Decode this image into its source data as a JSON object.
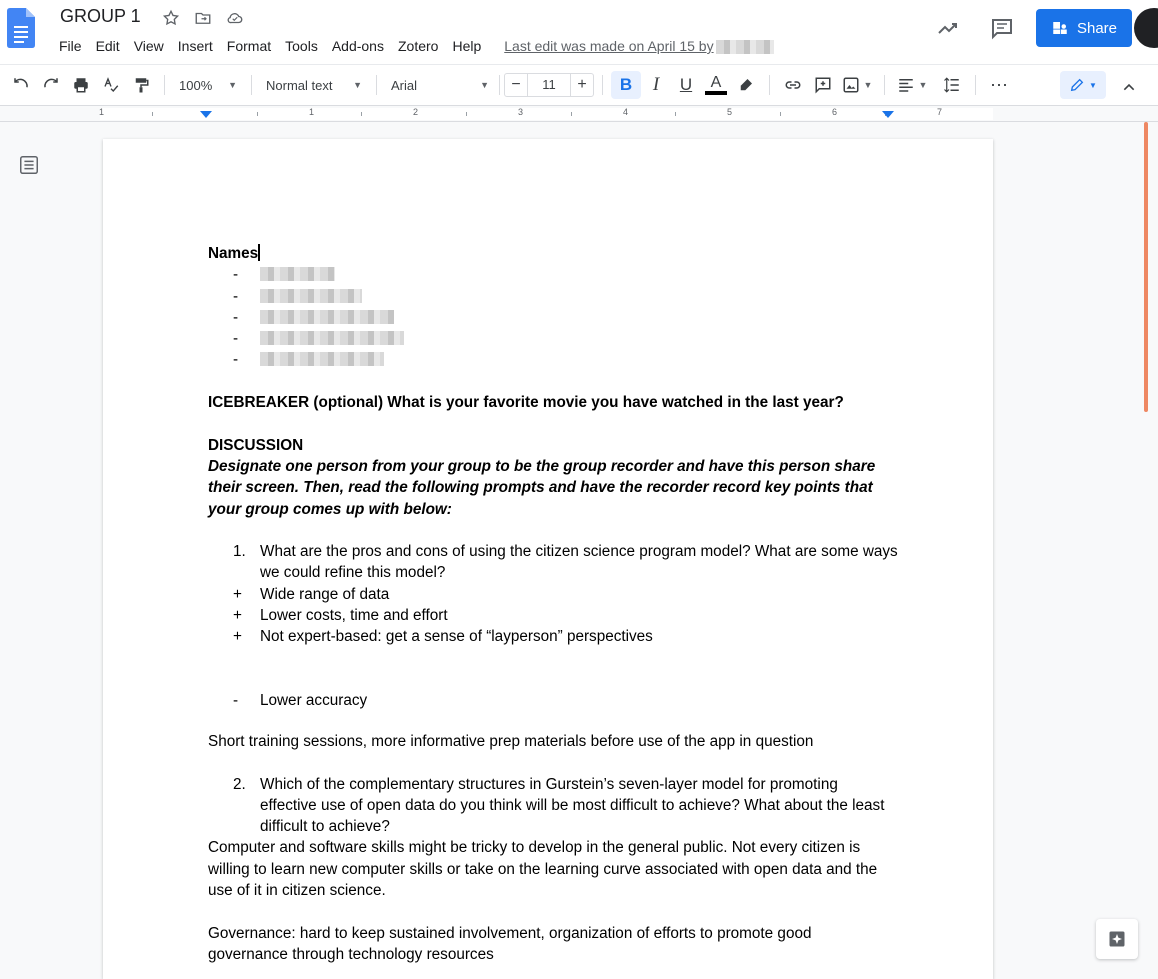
{
  "header": {
    "doc_title": "GROUP 1",
    "menu": [
      "File",
      "Edit",
      "View",
      "Insert",
      "Format",
      "Tools",
      "Add-ons",
      "Zotero",
      "Help"
    ],
    "last_edit": "Last edit was made on April 15 by",
    "share_label": "Share"
  },
  "toolbar": {
    "zoom": "100%",
    "style": "Normal text",
    "font": "Arial",
    "font_size": "11",
    "minus": "−",
    "plus": "+",
    "bold": "B",
    "italic": "I",
    "underline": "U",
    "text_color": "A",
    "more": "⋯"
  },
  "ruler": {
    "labels": [
      "1",
      "1",
      "2",
      "3",
      "4",
      "5",
      "6",
      "7"
    ]
  },
  "document": {
    "names_heading": "Names",
    "name_bullet": "-",
    "icebreaker": "ICEBREAKER (optional) What is your favorite movie you have watched in the last year?",
    "discussion_heading": "DISCUSSION",
    "discussion_instructions": "Designate one person from your group to be the group recorder and have this person share their screen. Then, read the following prompts and have the recorder record key points that your group comes up with below:",
    "q1_number": "1.",
    "q1": "What are the pros and cons of using the citizen science program model? What are some ways we could refine this model?",
    "pros": [
      {
        "marker": "+",
        "text": "Wide range of data"
      },
      {
        "marker": "+",
        "text": "Lower costs, time and effort"
      },
      {
        "marker": "+",
        "text": "Not expert-based:  get a sense of “layperson” perspectives"
      }
    ],
    "con_marker": "-",
    "con": "Lower accuracy",
    "refine": "Short training sessions, more informative prep materials before use of the app in question",
    "q2_number": "2.",
    "q2": "Which of the complementary structures in Gurstein’s seven-layer model for promoting effective use of open data do you think will be most difficult to achieve? What about the least difficult to achieve?",
    "answer1": "Computer and software skills might be tricky to develop in the general public. Not every citizen is willing to learn new computer skills or take on the learning curve associated with open data and the use of it in citizen science.",
    "answer2": "Governance: hard to keep sustained involvement, organization of efforts to promote good governance through technology resources"
  },
  "colors": {
    "accent": "#1a73e8",
    "scroll_thumb": "#ee8863"
  }
}
